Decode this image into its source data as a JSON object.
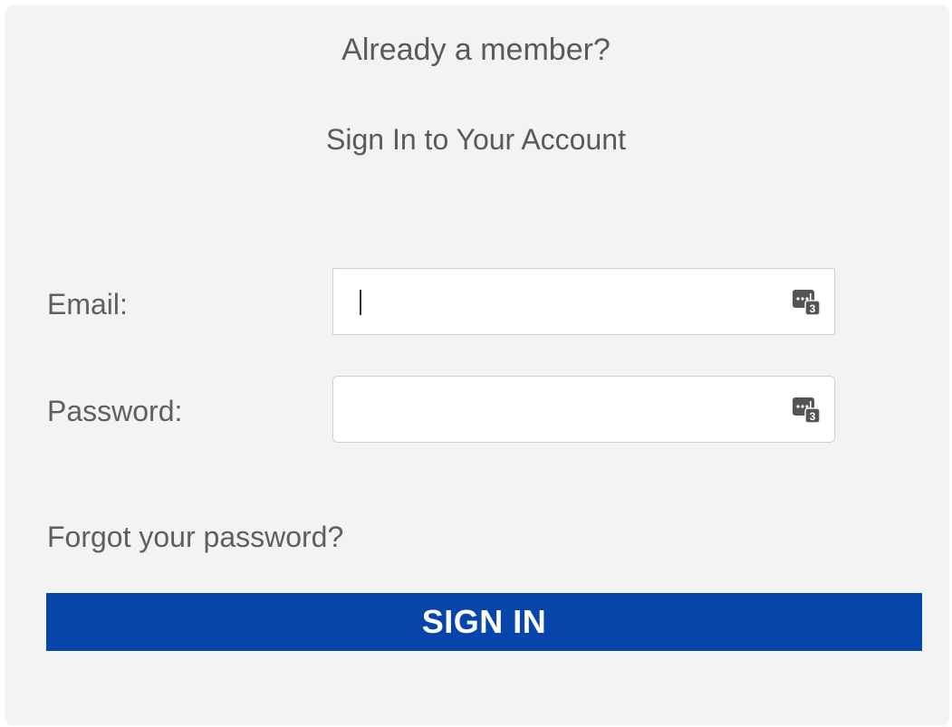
{
  "header": {
    "title": "Already a member?",
    "subtitle": "Sign In to Your Account"
  },
  "form": {
    "email": {
      "label": "Email:",
      "value": "",
      "placeholder": "",
      "icon": "password-manager-icon"
    },
    "password": {
      "label": "Password:",
      "value": "",
      "placeholder": "",
      "icon": "password-manager-icon"
    },
    "forgot_link": "Forgot your password?",
    "submit_label": "SIGN IN"
  },
  "colors": {
    "panel_background": "#f3f3f3",
    "primary_button": "#0645aa",
    "text": "#5f5f5f"
  }
}
